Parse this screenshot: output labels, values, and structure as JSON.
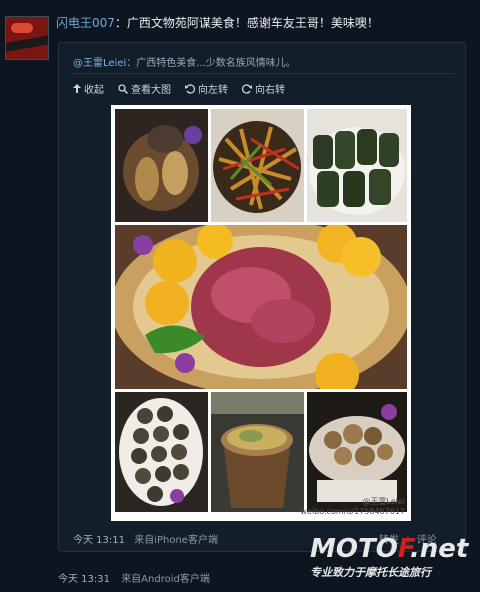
{
  "post": {
    "username": "闪电王007",
    "text": "：广西文物苑阿谋美食！感谢车友王哥！美味噢！",
    "timestamp": "今天 13:31",
    "source": "来自Android客户端"
  },
  "retweet": {
    "username": "@王雷Leiei",
    "text": "：广西特色美食...少数名族风情味儿。",
    "timestamp": "今天 13:11",
    "source": "来自iPhone客户端",
    "actions": {
      "forward": "转发",
      "comment": "评论"
    }
  },
  "toolbar": {
    "collapse": "收起",
    "view_large": "查看大图",
    "rotate_left": "向左转",
    "rotate_right": "向右转"
  },
  "image_watermark": {
    "handle": "@王雷Leiei",
    "url": "weibo.com/u/1758467617"
  },
  "logo": {
    "brand_part1": "MOTO",
    "brand_part2": "F",
    "brand_part3": ".net",
    "slogan": "专业致力于摩托长途旅行"
  },
  "colors": {
    "background": "#0d1620",
    "username": "#6ea7da",
    "brand_red": "#d02020"
  }
}
